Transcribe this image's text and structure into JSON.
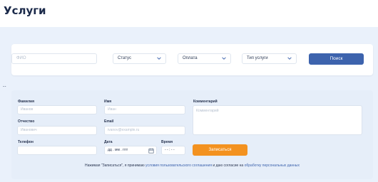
{
  "page": {
    "title": "Услуги"
  },
  "filters": {
    "name_placeholder": "ФИО",
    "status_label": "Статус",
    "payment_label": "Оплата",
    "service_type_label": "Тип услуги",
    "search_label": "Поиск"
  },
  "separator_text": "--",
  "form": {
    "surname_label": "Фамилия",
    "surname_placeholder": "Иванов",
    "name_label": "Имя",
    "name_placeholder": "Иван",
    "comment_label": "Комментарий",
    "comment_placeholder": "Комментарий",
    "patronymic_label": "Отчество",
    "patronymic_placeholder": "Иванович",
    "email_label": "Email",
    "email_placeholder": "ivanov@example.ru",
    "phone_label": "Телефон",
    "phone_value": "",
    "date_label": "Дата",
    "date_value": "дд . мм . гггг",
    "time_label": "Время",
    "time_value": "- - : - -",
    "submit_label": "Записаться"
  },
  "consent": {
    "prefix": "Нажимая \"Записаться\", я принимаю ",
    "terms_link": "условия пользовательского соглашения",
    "middle": " и даю согласие на ",
    "privacy_link": "обработку персональных данных"
  },
  "colors": {
    "primary": "#3d63ad",
    "accent": "#f39220",
    "band": "#eaf1fb"
  }
}
